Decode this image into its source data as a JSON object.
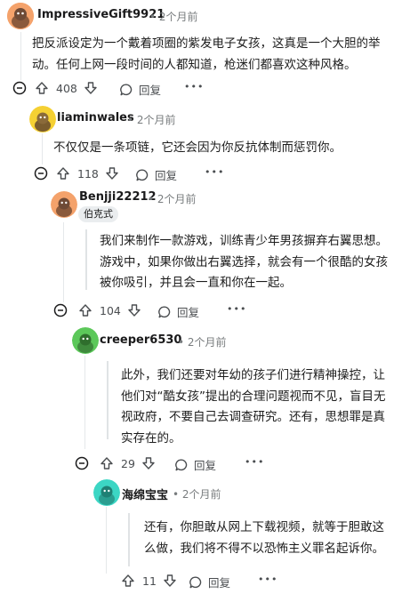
{
  "comments": [
    {
      "username": "ImpressiveGift9921",
      "time": "2个月前",
      "text": "把反派设定为一个戴着项圈的紫发电子女孩，这真是一个大胆的举动。任何上网一段时间的人都知道，枪迷们都喜欢这种风格。",
      "votes": "408",
      "reply": "回复",
      "more": "•••",
      "avatar_color": "#f4a26b"
    },
    {
      "username": "liaminwales",
      "time": "2个月前",
      "text": "不仅仅是一条项链，它还会因为你反抗体制而惩罚你。",
      "votes": "118",
      "reply": "回复",
      "more": "•••",
      "avatar_color": "#f5d033"
    },
    {
      "username": "Benjji22212",
      "flair": "伯克式",
      "time": "2个月前",
      "text": "我们来制作一款游戏，训练青少年男孩摒弃右翼思想。游戏中，如果你做出右翼选择，就会有一个很酷的女孩被你吸引，并且会一直和你在一起。",
      "votes": "104",
      "reply": "回复",
      "more": "•••",
      "avatar_color": "#f4a26b"
    },
    {
      "username": "creeper6530",
      "time": "2个月前",
      "text": "此外，我们还要对年幼的孩子们进行精神操控，让他们对“酷女孩”提出的合理问题视而不见，盲目无视政府，不要自己去调查研究。还有，思想罪是真实存在的。",
      "votes": "29",
      "reply": "回复",
      "more": "•••",
      "avatar_color": "#5cc85a"
    },
    {
      "username": "海绵宝宝",
      "time": "2个月前",
      "text": "还有，你胆敢从网上下载视频，就等于胆敢这么做，我们将不得不以恐怖主义罪名起诉你。",
      "votes": "11",
      "reply": "回复",
      "more": "•••",
      "avatar_color": "#3cd6c4"
    }
  ],
  "separator": "•"
}
